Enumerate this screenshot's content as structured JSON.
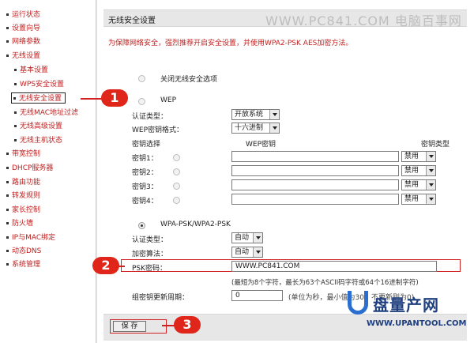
{
  "sidebar": {
    "items": [
      {
        "label": "运行状态"
      },
      {
        "label": "设置向导"
      },
      {
        "label": "网络参数"
      },
      {
        "label": "无线设置"
      },
      {
        "label": "基本设置"
      },
      {
        "label": "WPS安全设置"
      },
      {
        "label": "无线安全设置"
      },
      {
        "label": "无线MAC地址过滤"
      },
      {
        "label": "无线高级设置"
      },
      {
        "label": "无线主机状态"
      },
      {
        "label": "带宽控制"
      },
      {
        "label": "DHCP服务器"
      },
      {
        "label": "路由功能"
      },
      {
        "label": "转发规则"
      },
      {
        "label": "家长控制"
      },
      {
        "label": "防火墙"
      },
      {
        "label": "IP与MAC绑定"
      },
      {
        "label": "动态DNS"
      },
      {
        "label": "系统管理"
      }
    ]
  },
  "header": {
    "page_title": "无线安全设置",
    "site_title": "WWW.PC841.COM 电脑百事网"
  },
  "notice": "为保障网络安全，强烈推荐开启安全设置，并使用WPA2-PSK AES加密方法。",
  "options": {
    "disable_label": "关闭无线安全选项",
    "wep_label": "WEP",
    "auth_type_label": "认证类型：",
    "auth_type_value": "开放系统",
    "wep_format_label": "WEP密钥格式：",
    "wep_format_value": "十六进制",
    "key_select_header": "密钥选择",
    "wep_key_header": "WEP密钥",
    "key_type_header": "密钥类型",
    "keys": [
      {
        "label": "密钥1：",
        "type": "禁用"
      },
      {
        "label": "密钥2：",
        "type": "禁用"
      },
      {
        "label": "密钥3：",
        "type": "禁用"
      },
      {
        "label": "密钥4：",
        "type": "禁用"
      }
    ],
    "wpa_label": "WPA-PSK/WPA2-PSK",
    "wpa_auth_label": "认证类型：",
    "wpa_auth_value": "自动",
    "encrypt_label": "加密算法：",
    "encrypt_value": "自动",
    "psk_label": "PSK密码：",
    "psk_value": "WWW.PC841.COM",
    "psk_hint": "(最短为8个字符，最长为63个ASCII码字符或64个16进制字符)",
    "group_key_label": "组密钥更新周期：",
    "group_key_value": "0",
    "group_key_hint": "(单位为秒，最小值为30，不更新则为0)"
  },
  "footer": {
    "save_label": "保 存"
  },
  "badges": {
    "one": "1",
    "two": "2",
    "three": "3"
  },
  "watermark": {
    "cn": "盘量产网",
    "en": "WWW.UPANTOOL.COM"
  },
  "colors": {
    "accent_red": "#d21f1f",
    "sidebar_text": "#c02020"
  }
}
